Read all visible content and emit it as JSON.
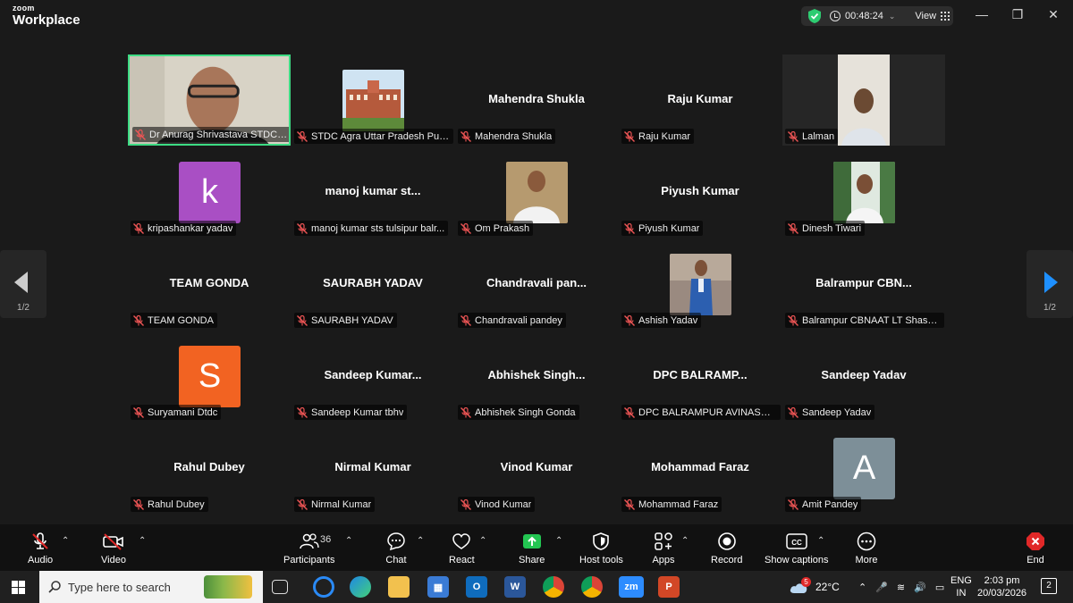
{
  "app": {
    "brand_small": "zoom",
    "brand_big": "Workplace"
  },
  "header": {
    "timer": "00:48:24",
    "view_label": "View"
  },
  "participants": [
    {
      "center_name": "",
      "label": "Dr Anurag Shrivastava STDC UP, ...",
      "type": "video"
    },
    {
      "center_name": "",
      "label": "STDC Agra Uttar Pradesh Pub...",
      "type": "photo-building"
    },
    {
      "center_name": "Mahendra Shukla",
      "label": "Mahendra Shukla",
      "type": "name"
    },
    {
      "center_name": "Raju Kumar",
      "label": "Raju Kumar",
      "type": "name"
    },
    {
      "center_name": "",
      "label": "Lalman",
      "type": "video-lalman"
    },
    {
      "center_name": "",
      "label": "kripashankar yadav",
      "type": "avatar",
      "letter": "k",
      "color": "#a94fc4"
    },
    {
      "center_name": "manoj kumar st...",
      "label": "manoj kumar sts tulsipur balr...",
      "type": "name"
    },
    {
      "center_name": "",
      "label": "Om Prakash",
      "type": "photo-person"
    },
    {
      "center_name": "Piyush Kumar",
      "label": "Piyush Kumar",
      "type": "name"
    },
    {
      "center_name": "",
      "label": "Dinesh Tiwari",
      "type": "photo-outdoor"
    },
    {
      "center_name": "TEAM GONDA",
      "label": "TEAM GONDA",
      "type": "name"
    },
    {
      "center_name": "SAURABH YADAV",
      "label": "SAURABH YADAV",
      "type": "name"
    },
    {
      "center_name": "Chandravali  pan...",
      "label": "Chandravali pandey",
      "type": "name"
    },
    {
      "center_name": "",
      "label": "Ashish Yadav",
      "type": "photo-suit"
    },
    {
      "center_name": "Balrampur  CBN...",
      "label": "Balrampur CBNAAT LT Shashik...",
      "type": "name"
    },
    {
      "center_name": "",
      "label": "Suryamani Dtdc",
      "type": "avatar",
      "letter": "S",
      "color": "#f26322"
    },
    {
      "center_name": "Sandeep  Kumar...",
      "label": "Sandeep Kumar tbhv",
      "type": "name"
    },
    {
      "center_name": "Abhishek  Singh...",
      "label": "Abhishek Singh Gonda",
      "type": "name"
    },
    {
      "center_name": "DPC  BALRAMP...",
      "label": "DPC BALRAMPUR AVINASH VI...",
      "type": "name"
    },
    {
      "center_name": "Sandeep Yadav",
      "label": "Sandeep Yadav",
      "type": "name"
    },
    {
      "center_name": "Rahul Dubey",
      "label": "Rahul Dubey",
      "type": "name"
    },
    {
      "center_name": "Nirmal Kumar",
      "label": "Nirmal Kumar",
      "type": "name"
    },
    {
      "center_name": "Vinod Kumar",
      "label": "Vinod Kumar",
      "type": "name"
    },
    {
      "center_name": "Mohammad Faraz",
      "label": "Mohammad Faraz",
      "type": "name"
    },
    {
      "center_name": "",
      "label": "Amit Pandey",
      "type": "avatar",
      "letter": "A",
      "color": "#7d8f98"
    }
  ],
  "nav": {
    "left_page": "1/2",
    "right_page": "1/2"
  },
  "toolbar": {
    "audio": "Audio",
    "video": "Video",
    "participants": "Participants",
    "participant_count": "36",
    "chat": "Chat",
    "react": "React",
    "share": "Share",
    "host_tools": "Host tools",
    "apps": "Apps",
    "record": "Record",
    "captions": "Show captions",
    "more": "More",
    "end": "End"
  },
  "taskbar": {
    "search_placeholder": "Type here to search",
    "temperature": "22°C",
    "weather_badge": "5",
    "lang_top": "ENG",
    "lang_bottom": "IN",
    "time": "2:03 pm",
    "date": "20/03/2026",
    "notif_count": "2"
  },
  "colors": {
    "accent_green": "#3ddc84",
    "nav_arrow": "#1e90ff",
    "end_red": "#e02828"
  }
}
